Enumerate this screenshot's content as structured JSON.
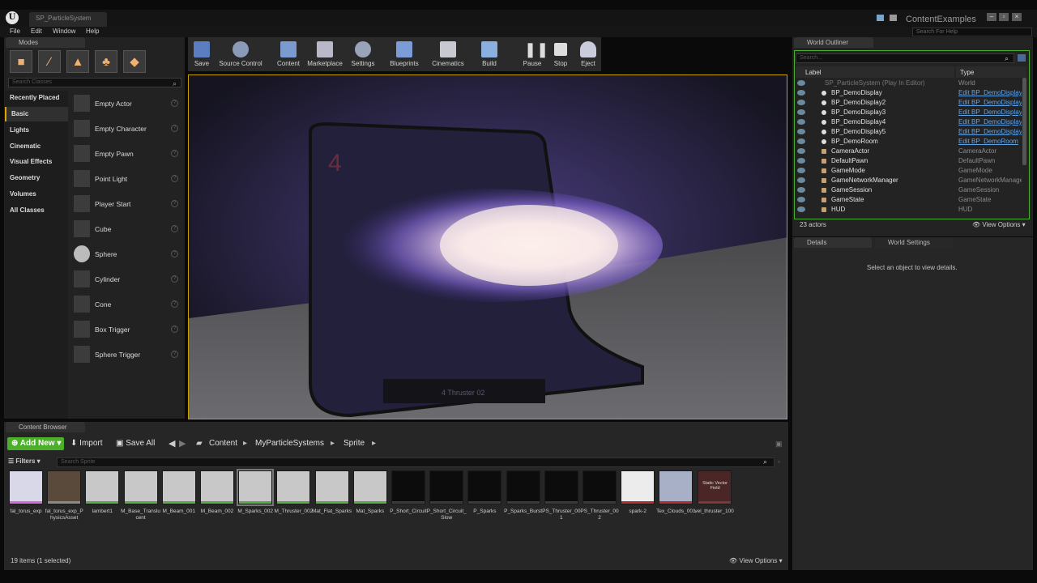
{
  "window": {
    "tab_title": "SP_ParticleSystem",
    "project": "ContentExamples",
    "logo": "U"
  },
  "menu": [
    "File",
    "Edit",
    "Window",
    "Help"
  ],
  "help_search": "Search For Help",
  "modes": {
    "tab": "Modes",
    "search_placeholder": "Search Classes",
    "categories": [
      "Recently Placed",
      "Basic",
      "Lights",
      "Cinematic",
      "Visual Effects",
      "Geometry",
      "Volumes",
      "All Classes"
    ],
    "items": [
      "Empty Actor",
      "Empty Character",
      "Empty Pawn",
      "Point Light",
      "Player Start",
      "Cube",
      "Sphere",
      "Cylinder",
      "Cone",
      "Box Trigger",
      "Sphere Trigger"
    ]
  },
  "toolbar": [
    "Save",
    "Source Control",
    "Content",
    "Marketplace",
    "Settings",
    "Blueprints",
    "Cinematics",
    "Build",
    "Pause",
    "Stop",
    "Eject"
  ],
  "viewport": {
    "sign_number": "4",
    "plate_text": "4 Thruster 02"
  },
  "outliner": {
    "tab": "World Outliner",
    "search_placeholder": "Search...",
    "col_label": "Label",
    "col_type": "Type",
    "root": {
      "label": "SP_ParticleSystem (Play In Editor)",
      "type": "World"
    },
    "rows": [
      {
        "label": "BP_DemoDisplay",
        "type": "Edit BP_DemoDisplay"
      },
      {
        "label": "BP_DemoDisplay2",
        "type": "Edit BP_DemoDisplay"
      },
      {
        "label": "BP_DemoDisplay3",
        "type": "Edit BP_DemoDisplay"
      },
      {
        "label": "BP_DemoDisplay4",
        "type": "Edit BP_DemoDisplay"
      },
      {
        "label": "BP_DemoDisplay5",
        "type": "Edit BP_DemoDisplay"
      },
      {
        "label": "BP_DemoRoom",
        "type": "Edit BP_DemoRoom"
      },
      {
        "label": "CameraActor",
        "type": "CameraActor"
      },
      {
        "label": "DefaultPawn",
        "type": "DefaultPawn"
      },
      {
        "label": "GameMode",
        "type": "GameMode"
      },
      {
        "label": "GameNetworkManager",
        "type": "GameNetworkManager"
      },
      {
        "label": "GameSession",
        "type": "GameSession"
      },
      {
        "label": "GameState",
        "type": "GameState"
      },
      {
        "label": "HUD",
        "type": "HUD"
      }
    ],
    "count": "23 actors",
    "view_options": "View Options"
  },
  "details": {
    "tab": "Details",
    "tab2": "World Settings",
    "empty_msg": "Select an object to view details."
  },
  "content_browser": {
    "tab": "Content Browser",
    "add_new": "Add New",
    "import": "Import",
    "save_all": "Save All",
    "path": [
      "Content",
      "MyParticleSystems",
      "Sprite"
    ],
    "filters": "Filters",
    "search_placeholder": "Search Sprite",
    "assets": [
      "fal_torus_exp",
      "fal_torus_exp_PhysicsAsset",
      "lambert1",
      "M_Base_Translucent",
      "M_Beam_001",
      "M_Beam_002",
      "M_Sparks_002",
      "M_Thruster_002",
      "Mat_Flat_Sparks",
      "Mat_Sparks",
      "P_Short_Circuit",
      "P_Short_Circuit_Slow",
      "P_Sparks",
      "P_Sparks_Burst",
      "PS_Thruster_001",
      "PS_Thruster_002",
      "spark-2",
      "Tex_Clouds_001",
      "vel_thruster_100"
    ],
    "field_thumb": "Static Vector Field",
    "status": "19 items (1 selected)",
    "view_options": "View Options"
  }
}
